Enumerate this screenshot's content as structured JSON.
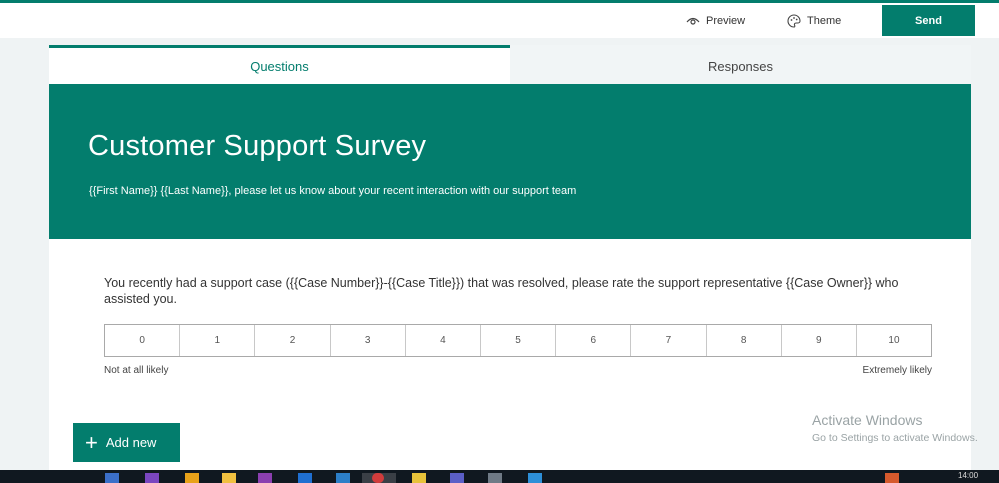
{
  "topbar": {
    "preview_label": "Preview",
    "theme_label": "Theme",
    "send_label": "Send"
  },
  "tabs": [
    {
      "label": "Questions",
      "active": true
    },
    {
      "label": "Responses",
      "active": false
    }
  ],
  "form": {
    "title": "Customer Support Survey",
    "subtitle": "{{First Name}} {{Last Name}}, please let us know about your recent interaction with our support team"
  },
  "question": {
    "text": "You recently had a support case ({{Case Number}}-{{Case Title}}) that was resolved, please rate the support representative {{Case Owner}} who assisted you.",
    "scale": [
      "0",
      "1",
      "2",
      "3",
      "4",
      "5",
      "6",
      "7",
      "8",
      "9",
      "10"
    ],
    "low_label": "Not at all likely",
    "high_label": "Extremely likely"
  },
  "add_new_label": "Add new",
  "watermark": {
    "line1": "Activate Windows",
    "line2": "Go to Settings to activate Windows."
  },
  "taskbar": {
    "clock": "14:00"
  },
  "colors": {
    "accent": "#037d6d",
    "background": "#eff3f4"
  }
}
